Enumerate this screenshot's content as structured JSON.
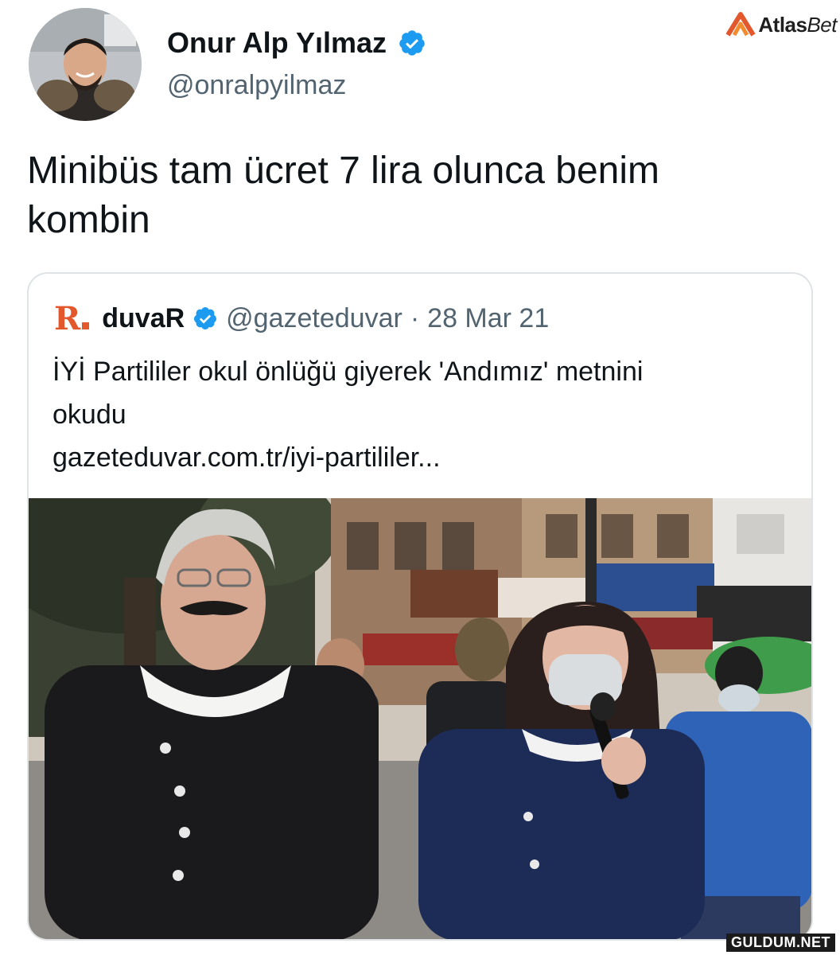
{
  "tweet": {
    "author": {
      "name": "Onur Alp Yılmaz",
      "handle": "@onralpyilmaz",
      "verified": true,
      "avatar": "profile-photo"
    },
    "text_lines": [
      "Minibüs tam ücret 7 lira olunca benim",
      "kombin"
    ],
    "quoted": {
      "logo": "R",
      "name": "duvaR",
      "handle": "@gazeteduvar",
      "separator": "·",
      "date": "28 Mar 21",
      "text_lines": [
        "İYİ Partililer okul önlüğü giyerek 'Andımız' metnini",
        "okudu"
      ],
      "link": "gazeteduvar.com.tr/iyi-partililer...",
      "image": "street-photo"
    }
  },
  "watermarks": {
    "brand_part1": "Atlas",
    "brand_part2": "Bet",
    "site": "GULDUM.NET"
  },
  "colors": {
    "verified": "#1d9bf0",
    "brand_orange": "#e2572b",
    "muted_text": "#536471",
    "card_border": "#dfe3e6"
  }
}
